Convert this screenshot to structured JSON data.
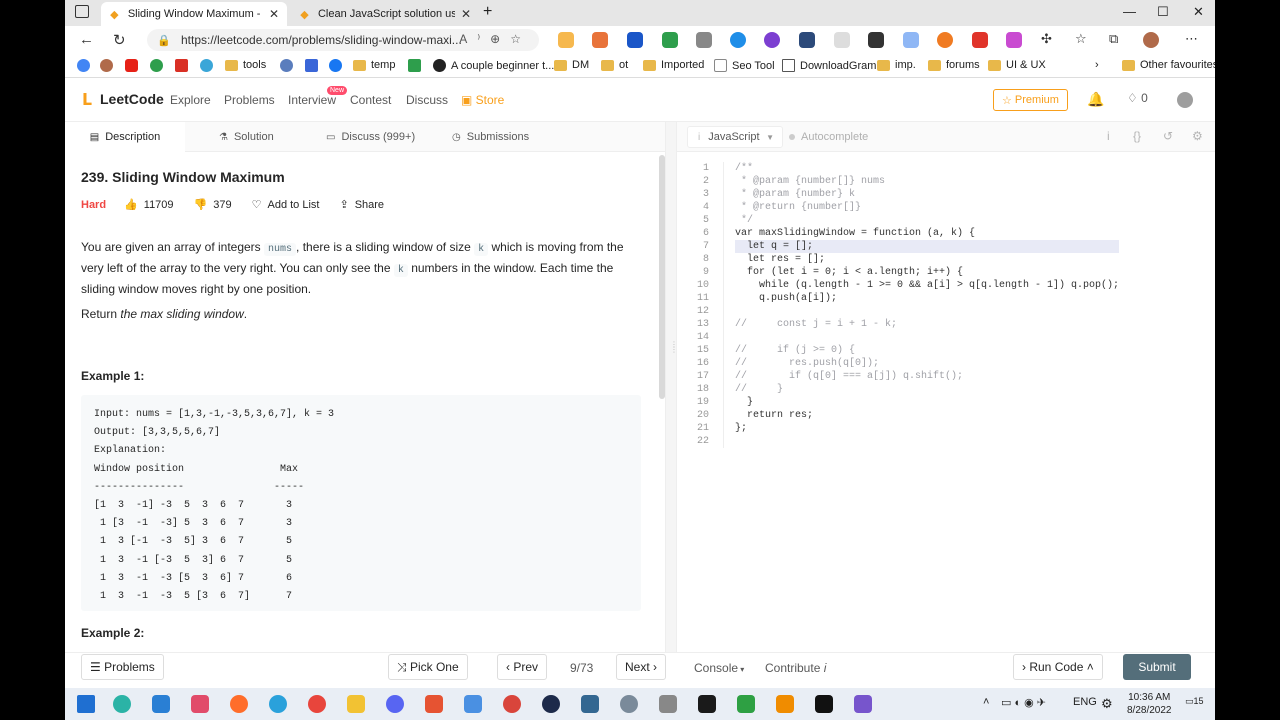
{
  "browser": {
    "tabs": [
      {
        "title": "Sliding Window Maximum - LeetC",
        "active": true
      },
      {
        "title": "Clean JavaScript solution using M",
        "active": false
      }
    ],
    "url": "https://leetcode.com/problems/sliding-window-maxi...",
    "bookmarks": [
      "tools",
      "temp",
      "A couple beginner t...",
      "DM",
      "ot",
      "Imported",
      "Seo Tool",
      "DownloadGram",
      "imp.",
      "forums",
      "UI & UX",
      "Other favourites"
    ]
  },
  "lcnav": {
    "logo": "LeetCode",
    "links": [
      "Explore",
      "Problems",
      "Interview",
      "Contest",
      "Discuss"
    ],
    "store": "Store",
    "new_badge": "New",
    "premium": "Premium",
    "streak": "0"
  },
  "left": {
    "tabs": [
      "Description",
      "Solution",
      "Discuss (999+)",
      "Submissions"
    ],
    "title": "239. Sliding Window Maximum",
    "difficulty": "Hard",
    "likes": "11709",
    "dislikes": "379",
    "add_to_list": "Add to List",
    "share": "Share",
    "desc_1": "You are given an array of integers ",
    "desc_code1": "nums",
    "desc_2": ", there is a sliding window of size ",
    "desc_code2": "k",
    "desc_3": " which is moving from the very left of the array to the very right. You can only see the ",
    "desc_code3": "k",
    "desc_4": " numbers in the window. Each time the sliding window moves right by one position.",
    "return_prefix": "Return ",
    "return_em": "the max sliding window",
    "return_suffix": ".",
    "example1_label": "Example 1:",
    "example1": "Input: nums = [1,3,-1,-3,5,3,6,7], k = 3\nOutput: [3,3,5,5,6,7]\nExplanation: \nWindow position                Max\n---------------               -----\n[1  3  -1] -3  5  3  6  7       3\n 1 [3  -1  -3] 5  3  6  7       3\n 1  3 [-1  -3  5] 3  6  7       5\n 1  3  -1 [-3  5  3] 6  7       5\n 1  3  -1  -3 [5  3  6] 7       6\n 1  3  -1  -3  5 [3  6  7]      7",
    "example2_label": "Example 2:"
  },
  "editor": {
    "language": "JavaScript",
    "autocomplete": "Autocomplete",
    "lines": [
      "/**",
      " * @param {number[]} nums",
      " * @param {number} k",
      " * @return {number[]}",
      " */",
      "var maxSlidingWindow = function (a, k) {",
      "  let q = [];",
      "  let res = [];",
      "  for (let i = 0; i < a.length; i++) {",
      "    while (q.length - 1 >= 0 && a[i] > q[q.length - 1]) q.pop();",
      "    q.push(a[i]);",
      "",
      "//     const j = i + 1 - k;",
      "",
      "//     if (j >= 0) {",
      "//       res.push(q[0]);",
      "//       if (q[0] === a[j]) q.shift();",
      "//     }",
      "  }",
      "  return res;",
      "};",
      ""
    ]
  },
  "footer": {
    "problems": "Problems",
    "pick_one": "Pick One",
    "prev": "Prev",
    "page": "9/73",
    "next": "Next",
    "console": "Console",
    "contribute": "Contribute",
    "run_code": "Run Code",
    "submit": "Submit"
  },
  "taskbar": {
    "lang": "ENG",
    "time": "10:36 AM",
    "date": "8/28/2022",
    "notif": "15"
  }
}
